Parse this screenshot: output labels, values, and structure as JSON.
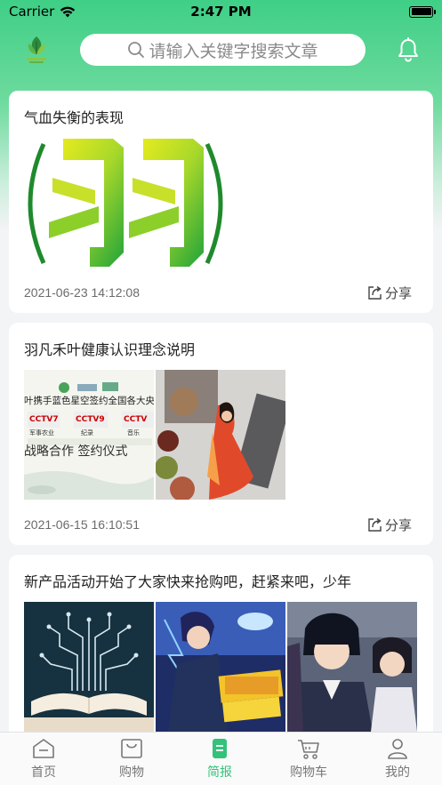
{
  "status_bar": {
    "carrier": "Carrier",
    "time": "2:47 PM"
  },
  "header": {
    "logo_icon": "leaf-logo-icon",
    "search_placeholder": "请输入关键字搜索文章",
    "bell_icon": "bell-icon"
  },
  "articles": [
    {
      "title": "气血失衡的表现",
      "date": "2021-06-23 14:12:08",
      "share_label": "分享"
    },
    {
      "title": "羽凡禾叶健康认识理念说明",
      "date": "2021-06-15 16:10:51",
      "share_label": "分享",
      "image_text": {
        "banner": "叶携手蓝色星空签约全国各大央",
        "tv1": "CCTV7",
        "tv1_sub": "军事农业",
        "tv2": "CCTV9",
        "tv2_sub": "纪录",
        "tv3": "CCTV",
        "tv3_sub": "音乐",
        "slogan": "战略合作  签约仪式"
      }
    },
    {
      "title": "新产品活动开始了大家快来抢购吧，赶紧来吧，少年"
    }
  ],
  "tabs": [
    {
      "label": "首页",
      "icon": "home-icon"
    },
    {
      "label": "购物",
      "icon": "shopping-bag-icon"
    },
    {
      "label": "简报",
      "icon": "briefing-icon"
    },
    {
      "label": "购物车",
      "icon": "cart-icon"
    },
    {
      "label": "我的",
      "icon": "user-icon"
    }
  ],
  "colors": {
    "accent": "#33c27a",
    "header_top": "#3fcf86"
  }
}
